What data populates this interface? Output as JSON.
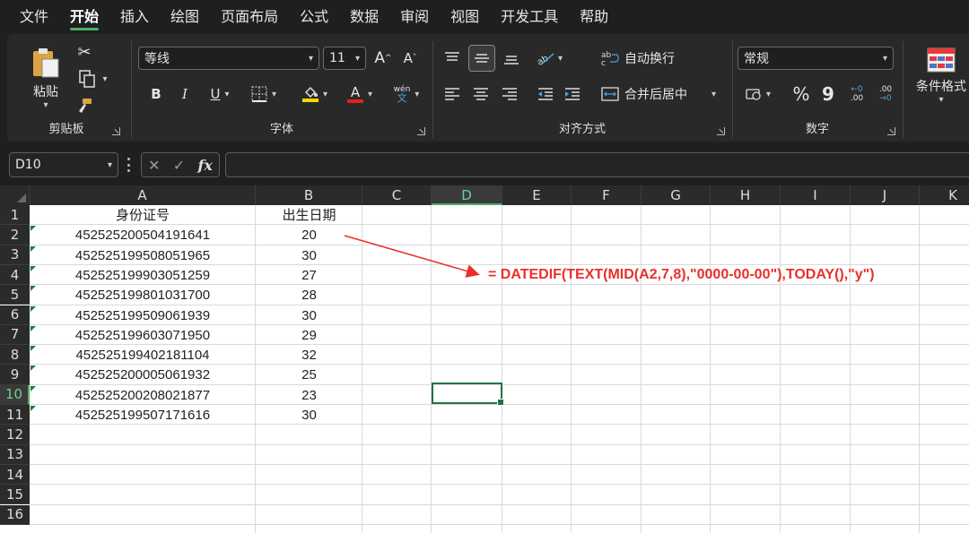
{
  "menu": {
    "tabs": [
      "文件",
      "开始",
      "插入",
      "绘图",
      "页面布局",
      "公式",
      "数据",
      "审阅",
      "视图",
      "开发工具",
      "帮助"
    ],
    "active_index": 1
  },
  "ribbon": {
    "clipboard": {
      "label": "剪贴板",
      "paste_label": "粘贴"
    },
    "font": {
      "label": "字体",
      "font_name": "等线",
      "font_size": "11",
      "phonetic_top": "wén",
      "phonetic_bottom": "文"
    },
    "alignment": {
      "label": "对齐方式",
      "wrap_label": "自动换行",
      "merge_label": "合并后居中"
    },
    "number": {
      "label": "数字",
      "format_value": "常规",
      "percent": "%",
      "comma": "9"
    },
    "styles": {
      "conditional_label": "条件格式"
    },
    "colors": {
      "highlight": "#f5d800",
      "font_color": "#e81f1f"
    }
  },
  "formula_bar": {
    "name_box": "D10",
    "fx": "fx",
    "formula": ""
  },
  "sheet": {
    "columns": [
      "A",
      "B",
      "C",
      "D",
      "E",
      "F",
      "G",
      "H",
      "I",
      "J",
      "K"
    ],
    "selected_column": "D",
    "selected_row": "10",
    "rows": [
      "1",
      "2",
      "3",
      "4",
      "5",
      "6",
      "7",
      "8",
      "9",
      "10",
      "11",
      "12",
      "13",
      "14",
      "15",
      "16"
    ],
    "header": {
      "a": "身份证号",
      "b": "出生日期"
    },
    "data": [
      {
        "id": "452525200504191641",
        "value": "20"
      },
      {
        "id": "452525199508051965",
        "value": "30"
      },
      {
        "id": "452525199903051259",
        "value": "27"
      },
      {
        "id": "452525199801031700",
        "value": "28"
      },
      {
        "id": "452525199509061939",
        "value": "30"
      },
      {
        "id": "452525199603071950",
        "value": "29"
      },
      {
        "id": "452525199402181104",
        "value": "32"
      },
      {
        "id": "452525200005061932",
        "value": "25"
      },
      {
        "id": "452525200208021877",
        "value": "23"
      },
      {
        "id": "452525199507171616",
        "value": "30"
      }
    ],
    "annotation": "=  DATEDIF(TEXT(MID(A2,7,8),\"0000-00-00\"),TODAY(),\"y\")",
    "annotation_color": "#e8302a",
    "selection_color": "#217346"
  }
}
